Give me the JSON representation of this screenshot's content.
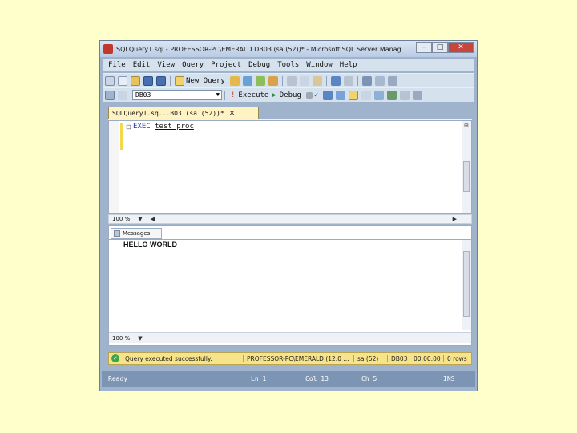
{
  "window": {
    "title": "SQLQuery1.sql - PROFESSOR-PC\\EMERALD.DB03 (sa (52))* - Microsoft SQL Server Manag...",
    "minimize": "–",
    "maximize": "□",
    "close": "✕"
  },
  "menu": [
    "File",
    "Edit",
    "View",
    "Query",
    "Project",
    "Debug",
    "Tools",
    "Window",
    "Help"
  ],
  "toolbar": {
    "new_query": "New Query",
    "database": "DB03",
    "execute": "Execute",
    "debug": "Debug"
  },
  "tab": {
    "label": "SQLQuery1.sq...B03 (sa (52))*",
    "close": "✕"
  },
  "editor": {
    "keyword": "EXEC",
    "code_rest": "test_proc",
    "zoom": "100 %"
  },
  "results": {
    "tab_label": "Messages",
    "output": "HELLO WORLD",
    "zoom": "100 %"
  },
  "query_status": {
    "message": "Query executed successfully.",
    "server": "PROFESSOR-PC\\EMERALD (12.0 ...",
    "user": "sa (52)",
    "database": "DB03",
    "elapsed": "00:00:00",
    "rows": "0 rows"
  },
  "statusbar": {
    "ready": "Ready",
    "ln": "Ln 1",
    "col": "Col 13",
    "ch": "Ch 5",
    "mode": "INS"
  },
  "colors": {
    "background": "#ffffcc",
    "tab_active": "#fff3c4",
    "status_ok": "#f7e38a",
    "statusbar": "#7d95b4"
  }
}
